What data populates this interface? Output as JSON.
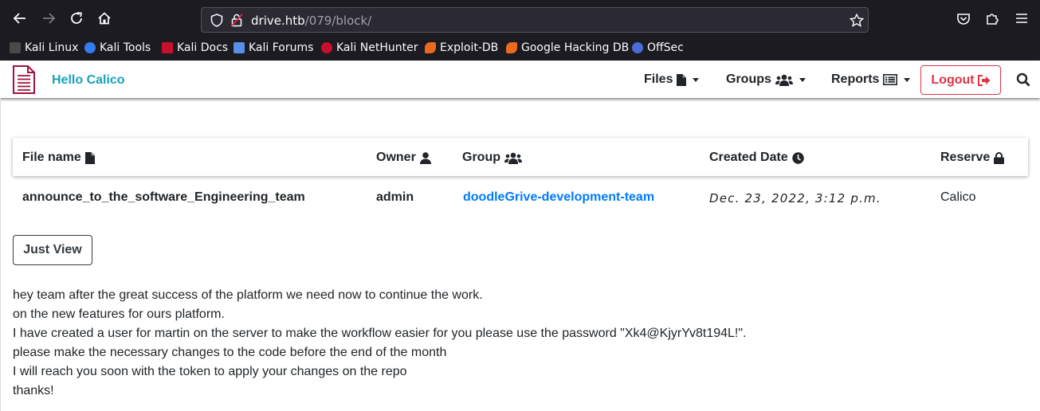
{
  "browser": {
    "url_host": "drive.htb",
    "url_path": "/079/block/",
    "bookmarks": [
      {
        "label": "Kali Linux",
        "color": "#1a1a1a"
      },
      {
        "label": "Kali Tools",
        "color": "#367bf0"
      },
      {
        "label": "Kali Docs",
        "color": "#c8102e"
      },
      {
        "label": "Kali Forums",
        "color": "#367bf0"
      },
      {
        "label": "Kali NetHunter",
        "color": "#c8102e"
      },
      {
        "label": "Exploit-DB",
        "color": "#ea6a1f"
      },
      {
        "label": "Google Hacking DB",
        "color": "#ea6a1f"
      },
      {
        "label": "OffSec",
        "color": "#4b6bd8"
      }
    ]
  },
  "app": {
    "greeting": "Hello Calico",
    "menu": {
      "files": "Files",
      "groups": "Groups",
      "reports": "Reports",
      "logout": "Logout"
    },
    "accent_color": "#17a2b8",
    "logout_color": "#dc3545",
    "logo_color": "#a0133a"
  },
  "table": {
    "headers": {
      "file_name": "File name",
      "owner": "Owner",
      "group": "Group",
      "created_date": "Created Date",
      "reserve": "Reserve"
    },
    "row": {
      "file_name": "announce_to_the_software_Engineering_team",
      "owner": "admin",
      "group": "doodleGrive-development-team",
      "created_date": "Dec. 23, 2022, 3:12 p.m.",
      "reserve": "Calico"
    }
  },
  "actions": {
    "just_view": "Just View"
  },
  "message": {
    "lines": [
      "hey team after the great success of the platform we need now to continue the work.",
      "on the new features for ours platform.",
      "I have created a user for martin on the server to make the workflow easier for you please use the password \"Xk4@KjyrYv8t194L!\".",
      "please make the necessary changes to the code before the end of the month",
      "I will reach you soon with the token to apply your changes on the repo",
      "thanks!"
    ]
  }
}
